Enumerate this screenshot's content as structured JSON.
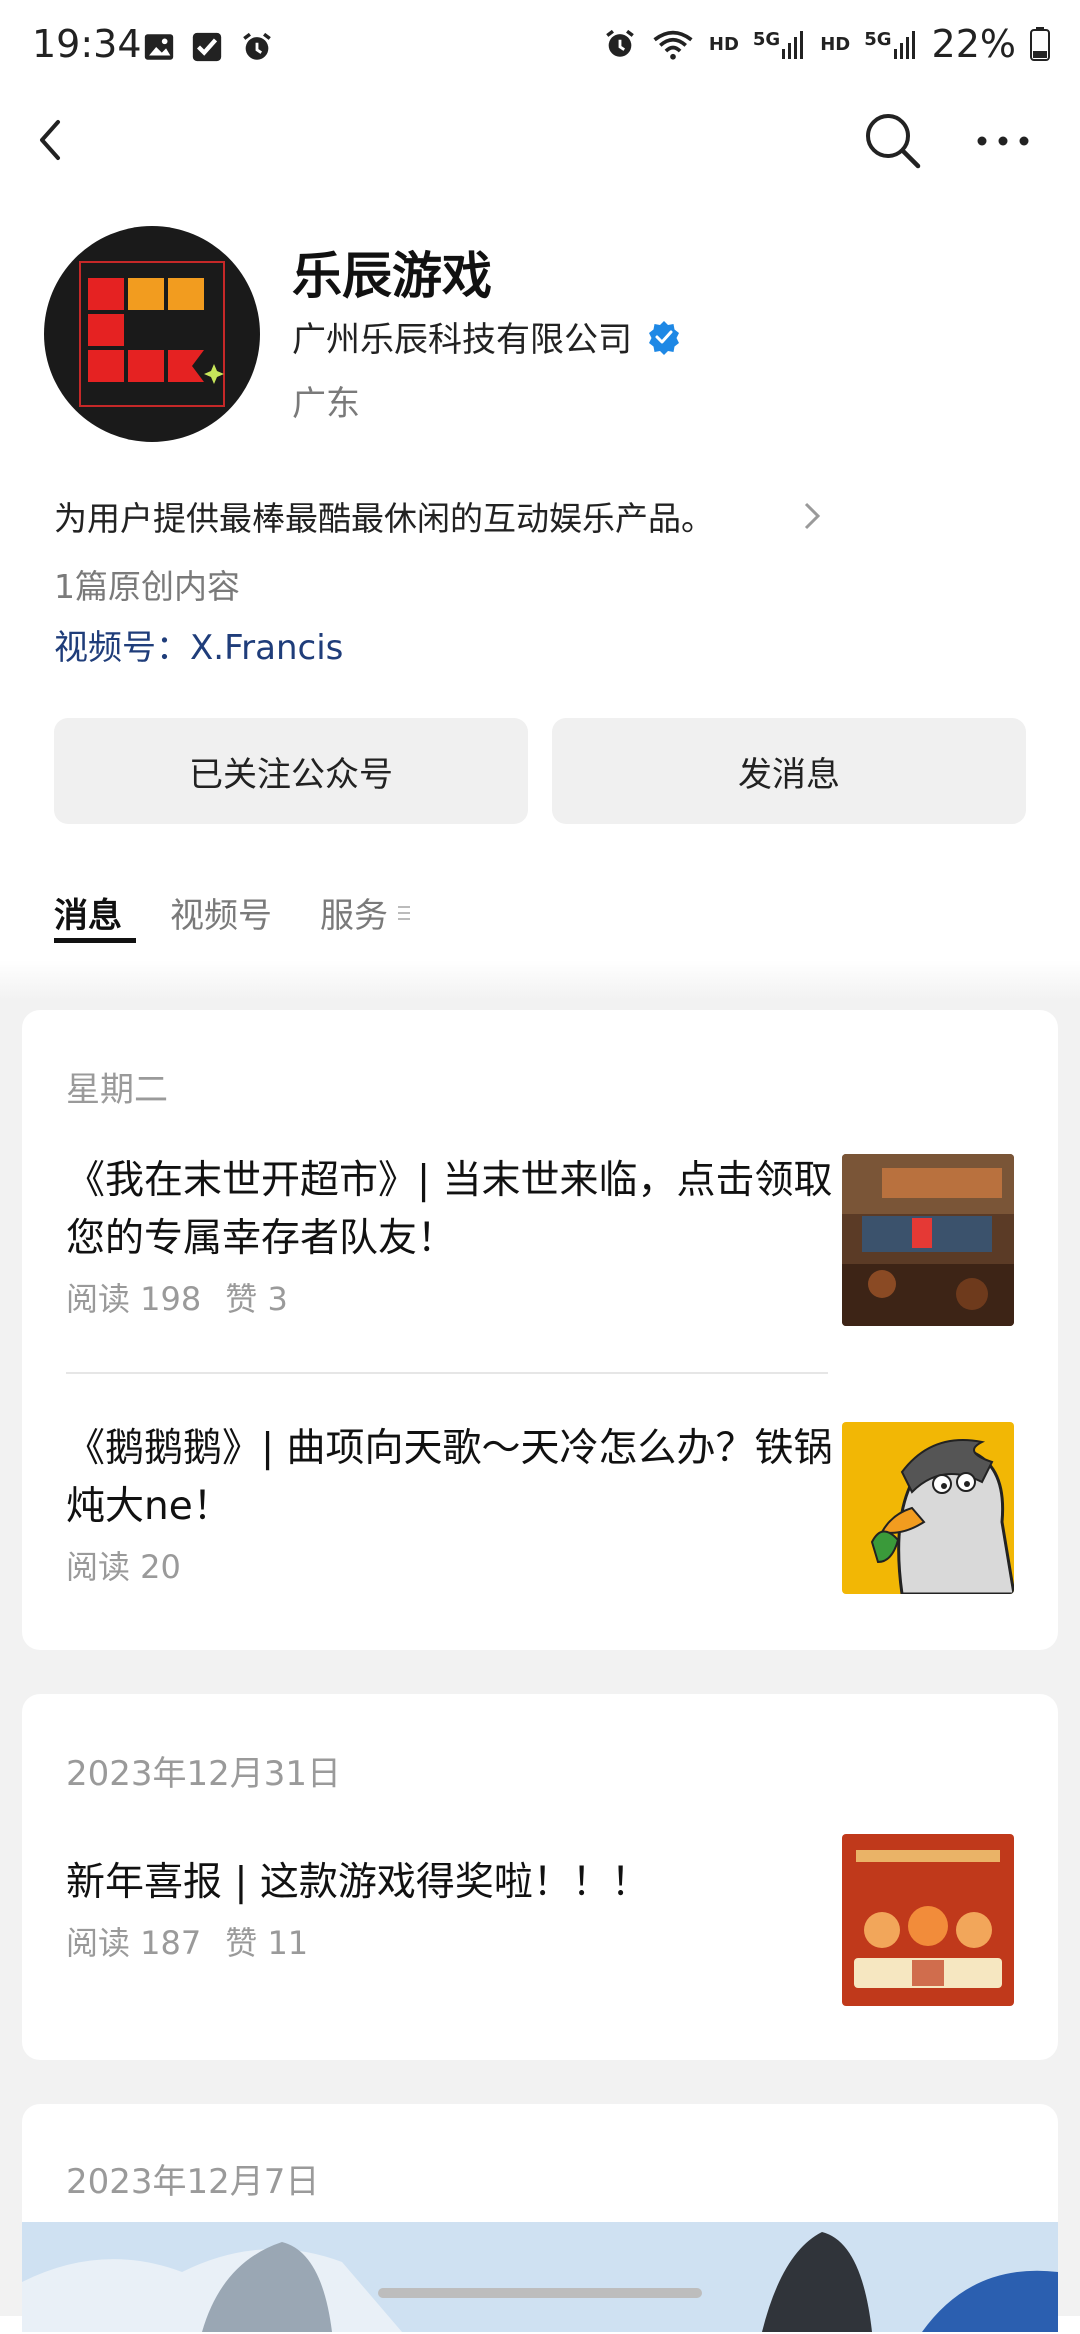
{
  "status_bar": {
    "time": "19:34",
    "hd1": "HD",
    "net1": "5G",
    "hd2": "HD",
    "net2": "5G",
    "battery": "22%"
  },
  "profile": {
    "name": "乐辰游戏",
    "company": "广州乐辰科技有限公司",
    "region": "广东",
    "description": "为用户提供最棒最酷最休闲的互动娱乐产品。",
    "original_count": "1篇原创内容",
    "video_channel": "视频号：X.Francis"
  },
  "actions": {
    "follow_label": "已关注公众号",
    "message_label": "发消息"
  },
  "tabs": [
    {
      "label": "消息"
    },
    {
      "label": "视频号"
    },
    {
      "label": "服务"
    }
  ],
  "feed": [
    {
      "date": "星期二",
      "articles": [
        {
          "title": "《我在末世开超市》| 当末世来临，点击领取您的专属幸存者队友！",
          "reads": "阅读 198",
          "likes": "赞 3"
        },
        {
          "title": "《鹅鹅鹅》| 曲项向天歌～天冷怎么办？铁锅炖大ne！",
          "reads": "阅读 20"
        }
      ]
    },
    {
      "date": "2023年12月31日",
      "articles": [
        {
          "title": "新年喜报 | 这款游戏得奖啦！！！",
          "reads": "阅读 187",
          "likes": "赞 11"
        }
      ]
    },
    {
      "date": "2023年12月7日"
    }
  ],
  "colors": {
    "link": "#1f3d7a",
    "verified": "#1e88e5",
    "button_bg": "#f0f0f0",
    "feed_bg": "#f2f2f2"
  }
}
